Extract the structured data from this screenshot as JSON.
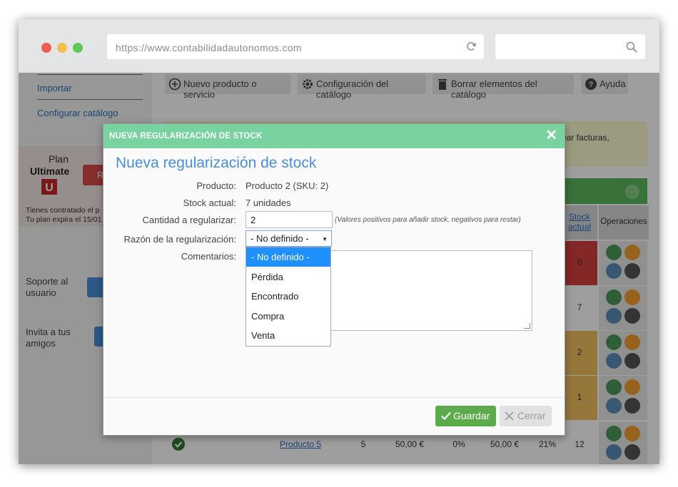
{
  "browser": {
    "url": "https://www.contabilidadautonomos.com"
  },
  "sidebar": {
    "links": [
      "Importar",
      "Configurar catálogo"
    ],
    "plan_label": "Plan",
    "plan_name": "Ultimate",
    "plan_logo": "U",
    "renew_label": "R",
    "plan_info_1": "Tienes contratado el p",
    "plan_info_2": "Tu plan expira el 15/01",
    "support": [
      "Soporte al",
      "usuario"
    ],
    "invite": [
      "Invita a tus",
      "amigos"
    ]
  },
  "toolbar": {
    "new_product": "Nuevo producto o servicio",
    "catalog_config": "Configuración del catálogo",
    "delete_catalog": "Borrar elementos del catálogo",
    "help": "Ayuda"
  },
  "notice": {
    "text": "ear facturas,"
  },
  "table": {
    "headers": {
      "stock_1": "Stock",
      "stock_2": "actual",
      "operations": "Operaciones"
    },
    "stock_values": [
      "0",
      "7",
      "2",
      "1",
      "12"
    ],
    "last_row": {
      "name": "Producto 5",
      "qty": "5",
      "price": "50,00 €",
      "discount": "0%",
      "total": "50,00 €",
      "tax": "21%",
      "stock": "12"
    }
  },
  "modal": {
    "header": "NUEVA REGULARIZACIÓN DE STOCK",
    "title": "Nueva regularización de stock",
    "labels": {
      "product": "Producto:",
      "stock": "Stock actual:",
      "qty": "Cantidad a regularizar:",
      "reason": "Razón de la regularización:",
      "comments": "Comentarios:"
    },
    "product_value": "Producto 2 (SKU: 2)",
    "stock_value": "7 unidades",
    "qty_value": "2",
    "qty_hint": "(Valores positivos para añadir stock, negativos para restar)",
    "reason_selected": "- No definido -",
    "reason_options": [
      "- No definido -",
      "Pérdida",
      "Encontrado",
      "Compra",
      "Venta"
    ],
    "save_label": "Guardar",
    "cancel_label": "Cerrar"
  },
  "colors": {
    "modal_header": "#79d3a0",
    "title": "#4a8ed6",
    "save": "#5cab4a",
    "selected_option": "#1e90ff"
  }
}
